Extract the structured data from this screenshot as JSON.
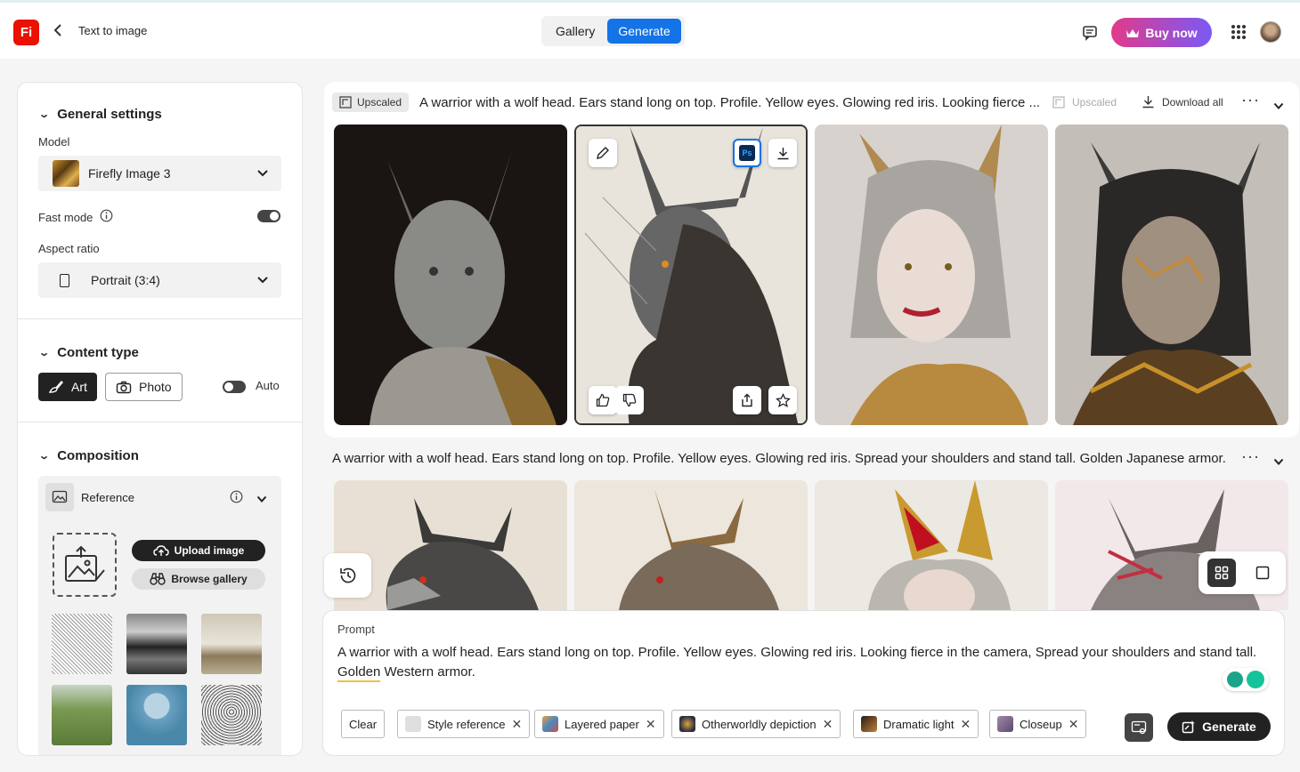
{
  "header": {
    "logo_text": "Fi",
    "app_title": "Text to image",
    "tabs": [
      {
        "label": "Gallery",
        "active": false
      },
      {
        "label": "Generate",
        "active": true
      }
    ],
    "buy_now": "Buy now",
    "accent": "#1473e6"
  },
  "sidebar": {
    "general": {
      "title": "General settings",
      "model_label": "Model",
      "model_value": "Firefly Image 3",
      "fast_mode_label": "Fast mode",
      "fast_mode_on": true,
      "aspect_label": "Aspect ratio",
      "aspect_value": "Portrait (3:4)"
    },
    "content_type": {
      "title": "Content type",
      "art": "Art",
      "photo": "Photo",
      "auto": "Auto",
      "selected": "Art"
    },
    "composition": {
      "title": "Composition",
      "reference_label": "Reference",
      "upload": "Upload image",
      "browse": "Browse gallery"
    }
  },
  "results": {
    "row1": {
      "badge": "Upscaled",
      "prompt": "A warrior with a wolf head. Ears stand long on top. Profile. Yellow eyes. Glowing red iris. Looking fierce ...",
      "upscaled": "Upscaled",
      "download_all": "Download all"
    },
    "row2": {
      "prompt": "A warrior with a wolf head. Ears stand long on top. Profile. Yellow eyes. Glowing red iris. Spread your shoulders and stand tall. Golden Japanese armor."
    }
  },
  "prompt_panel": {
    "label": "Prompt",
    "text": "A warrior with a wolf head. Ears stand long on top. Profile. Yellow eyes. Glowing red iris. Looking fierce in the camera, Spread your shoulders and stand tall. Golden Western armor.",
    "clear": "Clear",
    "chips": [
      {
        "label": "Style reference"
      },
      {
        "label": "Layered paper"
      },
      {
        "label": "Otherworldly depiction"
      },
      {
        "label": "Dramatic light"
      },
      {
        "label": "Closeup"
      }
    ],
    "generate": "Generate"
  }
}
